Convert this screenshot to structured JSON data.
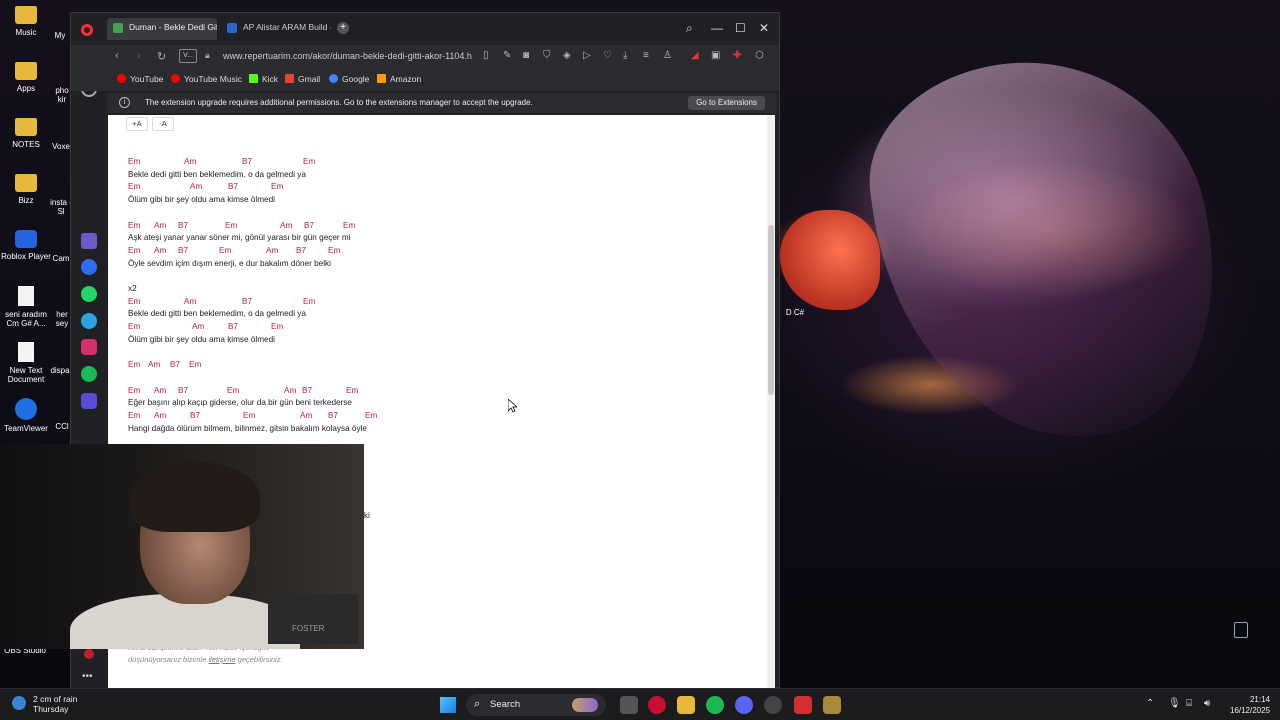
{
  "desktop": {
    "icons": [
      {
        "label": "Music"
      },
      {
        "label": "Apps"
      },
      {
        "label": "NOTES"
      },
      {
        "label": "Bizz"
      },
      {
        "label": "Roblox Player"
      },
      {
        "label": "seni aradım Cm G# A..."
      },
      {
        "label": "New Text Document"
      },
      {
        "label": "TeamViewer"
      },
      {
        "label": "OBS Studio"
      }
    ],
    "partial_labels": [
      "My",
      "pho kir",
      "Voxe",
      "insta - Sl",
      "Cam",
      "her sey",
      "dispa",
      "CCl",
      "D C#"
    ]
  },
  "browser": {
    "tabs": [
      {
        "label": "Duman - Bekle Dedi Gitti -",
        "active": true
      },
      {
        "label": "AP Alistar ARAM Build - U",
        "active": false
      }
    ],
    "address": {
      "badge": "V...",
      "url": "www.repertuarim.com/akor/duman-bekle-dedi-gitti-akor-1104.h"
    },
    "bookmarks": [
      {
        "label": "YouTube",
        "color": "#ff0000"
      },
      {
        "label": "YouTube Music",
        "color": "#ff0000"
      },
      {
        "label": "Kick",
        "color": "#53fc18"
      },
      {
        "label": "Gmail",
        "color": "#ea4335"
      },
      {
        "label": "Google",
        "color": "#4285f4"
      },
      {
        "label": "Amazon",
        "color": "#ff9900"
      }
    ],
    "extension_banner": {
      "message": "The extension upgrade requires additional permissions. Go to the extensions manager to accept the upgrade.",
      "button": "Go to Extensions"
    },
    "sidebar_icons": [
      "home-icon",
      "star-icon",
      "aria-icon",
      "messenger-icon",
      "whatsapp-icon",
      "telegram-icon",
      "instagram-icon",
      "spotify-icon",
      "player-icon",
      "more-icon"
    ]
  },
  "page": {
    "font_buttons": [
      "+A",
      "-A"
    ],
    "song_lines": [
      {
        "kind": "chord",
        "chords": [
          [
            "Em",
            0
          ],
          [
            "Am",
            56
          ],
          [
            "B7",
            114
          ],
          [
            "Em",
            175
          ]
        ]
      },
      {
        "kind": "lyric",
        "text": "Bekle dedi gitti ben beklemedim, o da gelmedi ya"
      },
      {
        "kind": "chord",
        "chords": [
          [
            "Em",
            0
          ],
          [
            "Am",
            62
          ],
          [
            "B7",
            100
          ],
          [
            "Em",
            143
          ]
        ]
      },
      {
        "kind": "lyric",
        "text": "Ölüm gibi bir şey oldu ama kimse ölmedi"
      },
      {
        "kind": "gap"
      },
      {
        "kind": "chord",
        "chords": [
          [
            "Em",
            0
          ],
          [
            "Am",
            26
          ],
          [
            "B7",
            50
          ],
          [
            "Em",
            97
          ],
          [
            "Am",
            152
          ],
          [
            "B7",
            176
          ],
          [
            "Em",
            215
          ]
        ]
      },
      {
        "kind": "lyric",
        "text": "Aşk ateşi yanar yanar söner mi, gönül yarası bir gün geçer mi"
      },
      {
        "kind": "chord",
        "chords": [
          [
            "Em",
            0
          ],
          [
            "Am",
            26
          ],
          [
            "B7",
            50
          ],
          [
            "Em",
            91
          ],
          [
            "Am",
            138
          ],
          [
            "B7",
            168
          ],
          [
            "Em",
            200
          ]
        ]
      },
      {
        "kind": "lyric",
        "text": "Öyle sevdim içim dışım enerji, e dur bakalım döner belki"
      },
      {
        "kind": "gap"
      },
      {
        "kind": "lyric",
        "text": "x2"
      },
      {
        "kind": "chord",
        "chords": [
          [
            "Em",
            0
          ],
          [
            "Am",
            56
          ],
          [
            "B7",
            114
          ],
          [
            "Em",
            175
          ]
        ]
      },
      {
        "kind": "lyric",
        "text": "Bekle dedi gitti ben beklemedim, o da gelmedi ya"
      },
      {
        "kind": "chord",
        "chords": [
          [
            "Em",
            0
          ],
          [
            "Am",
            64
          ],
          [
            "B7",
            100
          ],
          [
            "Em",
            143
          ]
        ]
      },
      {
        "kind": "lyric",
        "text": "Ölüm gibi bir şey oldu ama kimse ölmedi"
      },
      {
        "kind": "gap"
      },
      {
        "kind": "chord",
        "chords": [
          [
            "Em",
            0
          ],
          [
            "Am",
            20
          ],
          [
            "B7",
            42
          ],
          [
            "Em",
            61
          ]
        ]
      },
      {
        "kind": "gap"
      },
      {
        "kind": "chord",
        "chords": [
          [
            "Em",
            0
          ],
          [
            "Am",
            26
          ],
          [
            "B7",
            50
          ],
          [
            "Em",
            99
          ],
          [
            "Am",
            156
          ],
          [
            "B7",
            174
          ],
          [
            "Em",
            218
          ]
        ]
      },
      {
        "kind": "lyric",
        "text": "Eğer başını alıp kaçıp giderse, olur da bir gün beni terkederse"
      },
      {
        "kind": "chord",
        "chords": [
          [
            "Em",
            0
          ],
          [
            "Am",
            26
          ],
          [
            "B7",
            62
          ],
          [
            "Em",
            115
          ],
          [
            "Am",
            172
          ],
          [
            "B7",
            200
          ],
          [
            "Em",
            237
          ]
        ]
      },
      {
        "kind": "lyric",
        "text": "Hangi dağda ölürüm bilmem, bilinmez, gitsin bakalım kolaysa öyle"
      }
    ],
    "partial_text": "ki",
    "footer": {
      "line1": "kendi sahiplerine aittir. Telif hakkı içerdiğini",
      "line2_prefix": "düşünüyorsanız bizimle ",
      "line2_link": "iletişime",
      "line2_suffix": " geçebilirsiniz."
    }
  },
  "webcam": {
    "poster_text": "FOSTER"
  },
  "taskbar": {
    "weather_text": "2 cm of rain",
    "weather_day": "Thursday",
    "search_label": "Search",
    "time": "21:14",
    "date": "16/12/2025"
  }
}
